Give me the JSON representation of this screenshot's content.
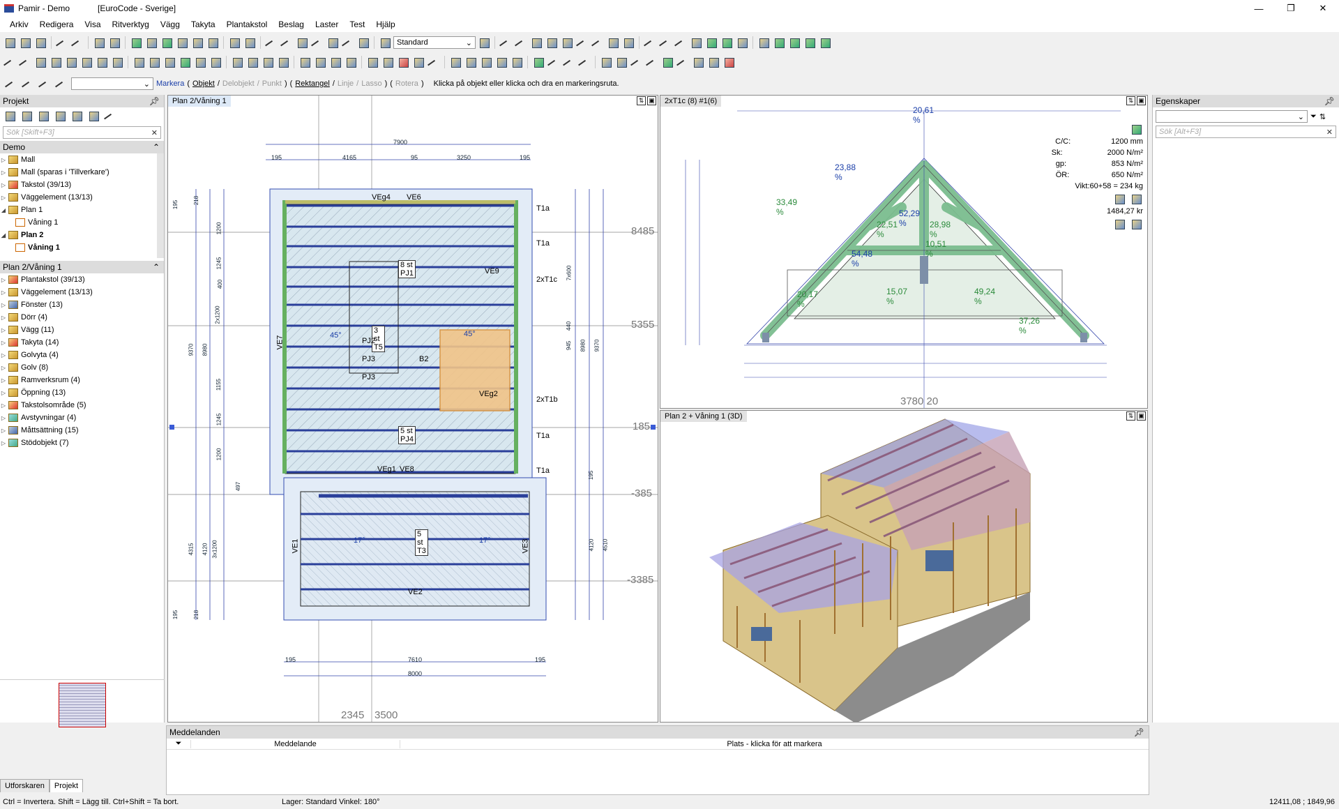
{
  "window": {
    "app_title": "Pamir - Demo",
    "code_title": "[EuroCode - Sverige]"
  },
  "menu": [
    "Arkiv",
    "Redigera",
    "Visa",
    "Ritverktyg",
    "Vägg",
    "Takyta",
    "Plantakstol",
    "Beslag",
    "Laster",
    "Test",
    "Hjälp"
  ],
  "toolbar": {
    "style_select": "Standard"
  },
  "markbar": {
    "markera": "Markera",
    "items": [
      "Objekt",
      "Delobjekt",
      "Punkt",
      "Rektangel",
      "Linje",
      "Lasso",
      "Rotera"
    ],
    "hint": "Klicka på objekt eller klicka och dra en markeringsruta."
  },
  "project_panel": {
    "title": "Projekt",
    "search_placeholder": "Sök [Skift+F3]",
    "group_title": "Demo",
    "items": [
      {
        "label": "Mall"
      },
      {
        "label": "Mall (sparas i 'Tillverkare')"
      },
      {
        "label": "Takstol (39/13)"
      },
      {
        "label": "Väggelement (13/13)"
      },
      {
        "label": "Plan 1"
      },
      {
        "label": "Våning 1"
      },
      {
        "label": "Plan 2"
      },
      {
        "label": "Våning 1"
      }
    ]
  },
  "level_panel": {
    "title": "Plan 2/Våning 1",
    "items": [
      {
        "label": "Plantakstol (39/13)"
      },
      {
        "label": "Väggelement (13/13)"
      },
      {
        "label": "Fönster (13)"
      },
      {
        "label": "Dörr (4)"
      },
      {
        "label": "Vägg (11)"
      },
      {
        "label": "Takyta (14)"
      },
      {
        "label": "Golvyta (4)"
      },
      {
        "label": "Golv (8)"
      },
      {
        "label": "Ramverksrum (4)"
      },
      {
        "label": "Öppning (13)"
      },
      {
        "label": "Takstolsområde (5)"
      },
      {
        "label": "Avstyvningar (4)"
      },
      {
        "label": "Måttsättning (15)"
      },
      {
        "label": "Stödobjekt (7)"
      }
    ]
  },
  "bottom_tabs": [
    "Utforskaren",
    "Projekt"
  ],
  "plan_view": {
    "title": "Plan 2/Våning 1",
    "dims_top": [
      "7900",
      "195",
      "4165",
      "95",
      "3250",
      "195"
    ],
    "dims_bottom": [
      "7610",
      "195",
      "195",
      "8000"
    ],
    "levels": [
      "8485",
      "5355",
      "185",
      "-385",
      "-3385"
    ],
    "bottom_coords": [
      "2345",
      "3500"
    ],
    "labels": {
      "veg4": "VEg4",
      "ve6": "VE6",
      "t1a_1": "T1a",
      "t1a_2": "T1a",
      "t1c": "2xT1c",
      "t1b": "2xT1b",
      "t1a_3": "T1a",
      "t1a_4": "T1a",
      "pj1": "8 st PJ1",
      "t5": "3 st T5",
      "pj4": "5 st PJ4",
      "t3": "5 st T3",
      "ve9": "VE9",
      "ve7": "VE7",
      "ve1": "VE1",
      "ve3": "VE3",
      "ve2": "VE2",
      "b2": "B2",
      "veg2": "VEg2",
      "a45a": "45°",
      "a45b": "45°",
      "a17a": "17°",
      "a17b": "17°",
      "veg1": "VEg1",
      "ve8": "VE8",
      "pj2": "PJ2",
      "pj3": "PJ3",
      "pj5": "PJ3",
      "left_dims": [
        "9370",
        "8980",
        "1200",
        "1245",
        "400",
        "2x1200",
        "1155",
        "1245",
        "1200",
        "195",
        "218",
        "4315",
        "4120",
        "3x1200",
        "195",
        "218",
        "497"
      ],
      "right_dims": [
        "7x600",
        "440",
        "945",
        "8980",
        "9370",
        "195",
        "4120",
        "4510"
      ]
    }
  },
  "truss_view": {
    "title": "2xT1c (8) #1(6)",
    "top_pct": "20,61 %",
    "pcts": [
      "23,88 %",
      "33,49 %",
      "52,29 %",
      "22,51 %",
      "28,98 %",
      "10,51 %",
      "54,48 %",
      "20,17 %",
      "15,07 %",
      "49,24 %",
      "37,26 %"
    ],
    "bottom_coords": [
      "3780",
      "20"
    ],
    "props": [
      {
        "k": "C/C:",
        "v": "1200 mm"
      },
      {
        "k": "Sk:",
        "v": "2000 N/m²"
      },
      {
        "k": "gp:",
        "v": "853 N/m²"
      },
      {
        "k": "ÖR:",
        "v": "650 N/m²"
      },
      {
        "k": "Vikt:",
        "v": "60+58 = 234 kg"
      }
    ],
    "price": "1484,27 kr"
  },
  "view3d": {
    "title": "Plan 2 + Våning 1 (3D)"
  },
  "properties": {
    "title": "Egenskaper",
    "search_placeholder": "Sök [Alt+F3]"
  },
  "messages": {
    "title": "Meddelanden",
    "col1": "Meddelande",
    "col2": "Plats - klicka för att markera"
  },
  "status": {
    "left": "Ctrl = Invertera. Shift = Lägg till. Ctrl+Shift = Ta bort.",
    "layer": "Lager: Standard  Vinkel: 180°",
    "coords": "12411,08 ; 1849,96"
  }
}
